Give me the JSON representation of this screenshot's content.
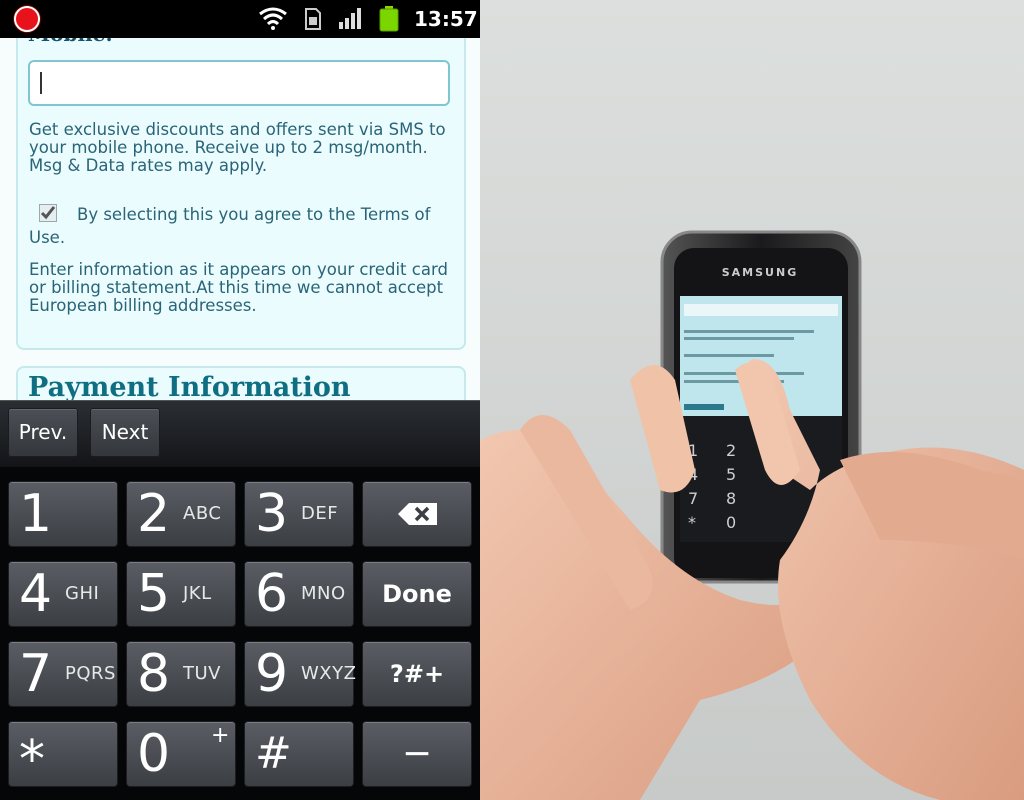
{
  "status_bar": {
    "time": "13:57",
    "icons": [
      "record-icon",
      "wifi-icon",
      "sim-icon",
      "signal-icon",
      "battery-icon"
    ]
  },
  "form": {
    "mobile_label": "Mobile:",
    "mobile_value": "",
    "sms_text": "Get exclusive discounts and offers sent via SMS to your mobile phone. Receive up to 2 msg/month. Msg & Data rates may apply.",
    "terms_checked": true,
    "terms_text": "By selecting this you agree to the Terms of Use.",
    "billing_text": "Enter information as it appears on your credit card or billing statement.At this time we cannot accept European billing addresses.",
    "payment_title": "Payment Information"
  },
  "keyboard": {
    "prev_label": "Prev.",
    "next_label": "Next",
    "keys": {
      "k1": {
        "num": "1",
        "sub": ""
      },
      "k2": {
        "num": "2",
        "sub": "ABC"
      },
      "k3": {
        "num": "3",
        "sub": "DEF"
      },
      "k4": {
        "num": "4",
        "sub": "GHI"
      },
      "k5": {
        "num": "5",
        "sub": "JKL"
      },
      "k6": {
        "num": "6",
        "sub": "MNO"
      },
      "k7": {
        "num": "7",
        "sub": "PQRS"
      },
      "k8": {
        "num": "8",
        "sub": "TUV"
      },
      "k9": {
        "num": "9",
        "sub": "WXYZ"
      },
      "kstar": {
        "num": "*"
      },
      "k0": {
        "num": "0",
        "sub": "+"
      },
      "khash": {
        "num": "#"
      },
      "done": "Done",
      "symbols": "?#+",
      "minus": "−"
    }
  },
  "photo": {
    "device_brand": "SAMSUNG",
    "colors": {
      "background": "#d6d9d7",
      "skin": "#e9b69c",
      "device": "#1b1b1d"
    }
  }
}
